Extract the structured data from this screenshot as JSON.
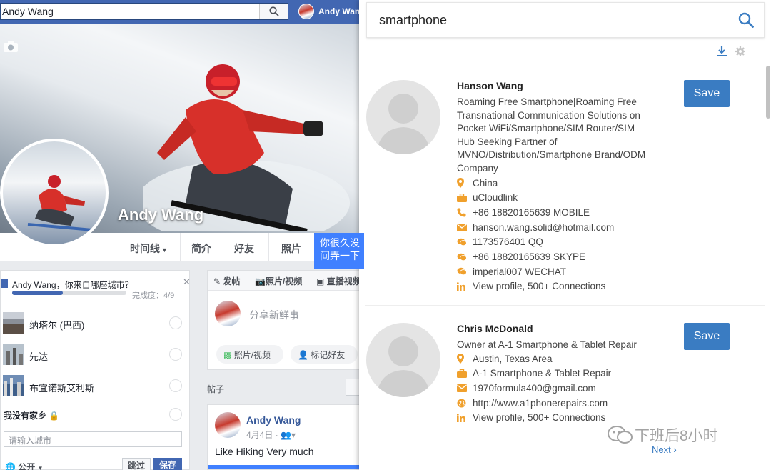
{
  "facebook": {
    "search_value": "Andy Wang",
    "user_name": "Andy Wang",
    "profile_name": "Andy Wang",
    "tabs": [
      {
        "label": "时间线",
        "has_caret": true
      },
      {
        "label": "简介"
      },
      {
        "label": "好友"
      },
      {
        "label": "照片"
      }
    ],
    "tooltip_lines": [
      "你很久没",
      "间弄一下"
    ],
    "city_card": {
      "question": "Andy Wang，你来自哪座城市？",
      "progress_label": "完成度：4/9",
      "progress": 0.444,
      "cities": [
        {
          "name": "纳塔尔 (巴西)"
        },
        {
          "name": "先达"
        },
        {
          "name": "布宜诺斯艾利斯"
        }
      ],
      "hometown_label": "我没有家乡",
      "input_placeholder": "请输入城市",
      "privacy_label": "公开",
      "skip_label": "跳过",
      "save_label": "保存"
    },
    "composer": {
      "tabs": [
        "发帖",
        "照片/视频",
        "直播视频"
      ],
      "prompt": "分享新鲜事",
      "buttons": [
        "照片/视频",
        "标记好友"
      ]
    },
    "posts_label": "帖子",
    "post": {
      "author": "Andy Wang",
      "date": "4月4日",
      "text": "Like Hiking Very much"
    }
  },
  "extension": {
    "search_value": "smartphone",
    "results": [
      {
        "name": "Hanson Wang",
        "headline": "Roaming Free Smartphone|Roaming Free Transnational Communication Solutions on Pocket WiFi/Smartphone/SIM Router/SIM Hub Seeking Partner of MVNO/Distribution/Smartphone Brand/ODM Company",
        "save_label": "Save",
        "fields": [
          {
            "icon": "location-pin-icon",
            "text": "China"
          },
          {
            "icon": "briefcase-icon",
            "text": "uCloudlink"
          },
          {
            "icon": "phone-icon",
            "text": "+86 18820165639 MOBILE"
          },
          {
            "icon": "envelope-icon",
            "text": "hanson.wang.solid@hotmail.com"
          },
          {
            "icon": "chat-icon",
            "text": "1173576401 QQ"
          },
          {
            "icon": "chat-icon",
            "text": "+86 18820165639 SKYPE"
          },
          {
            "icon": "chat-icon",
            "text": "imperial007 WECHAT"
          },
          {
            "icon": "linkedin-icon",
            "text": "View profile, 500+ Connections"
          }
        ]
      },
      {
        "name": "Chris McDonald",
        "headline": "Owner at A-1 Smartphone & Tablet Repair",
        "save_label": "Save",
        "fields": [
          {
            "icon": "location-pin-icon",
            "text": "Austin, Texas Area"
          },
          {
            "icon": "briefcase-icon",
            "text": "A-1 Smartphone & Tablet Repair"
          },
          {
            "icon": "envelope-icon",
            "text": "1970formula400@gmail.com"
          },
          {
            "icon": "globe-icon",
            "text": "http://www.a1phonerepairs.com"
          },
          {
            "icon": "linkedin-icon",
            "text": "View profile, 500+ Connections"
          }
        ]
      }
    ],
    "next_label": "Next",
    "watermark": "下班后8小时"
  },
  "colors": {
    "facebook_blue": "#4267b2",
    "save_blue": "#3a7cc2",
    "field_icon_orange": "#f0a02c",
    "linkedin_blue": "#0077b5"
  }
}
